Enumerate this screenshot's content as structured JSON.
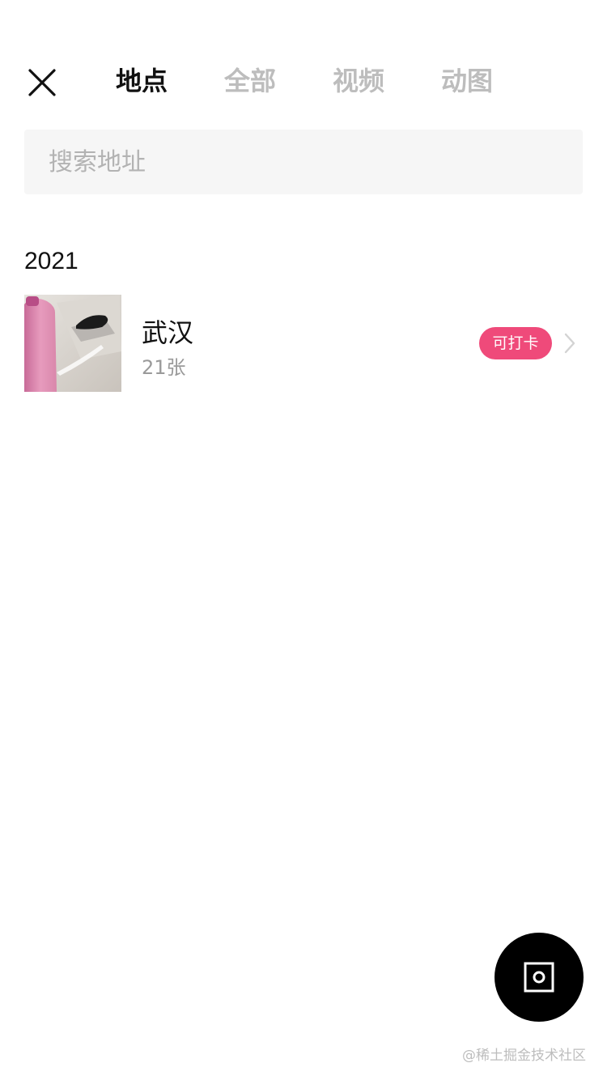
{
  "header": {
    "tabs": [
      {
        "label": "地点",
        "active": true
      },
      {
        "label": "全部",
        "active": false
      },
      {
        "label": "视频",
        "active": false
      },
      {
        "label": "动图",
        "active": false
      }
    ],
    "close_icon": "close-icon"
  },
  "search": {
    "placeholder": "搜索地址",
    "value": ""
  },
  "groups": [
    {
      "year": "2021",
      "places": [
        {
          "name": "武汉",
          "count": "21张",
          "badge": "可打卡",
          "thumbnail_icon": "photo-thumbnail"
        }
      ]
    }
  ],
  "fab": {
    "icon": "camera-frame-icon"
  },
  "watermark": "@稀土掘金技术社区",
  "colors": {
    "badge": "#ef4a7a",
    "active_tab": "#111111",
    "inactive_tab": "#bdbdbd",
    "search_bg": "#f6f6f6"
  }
}
